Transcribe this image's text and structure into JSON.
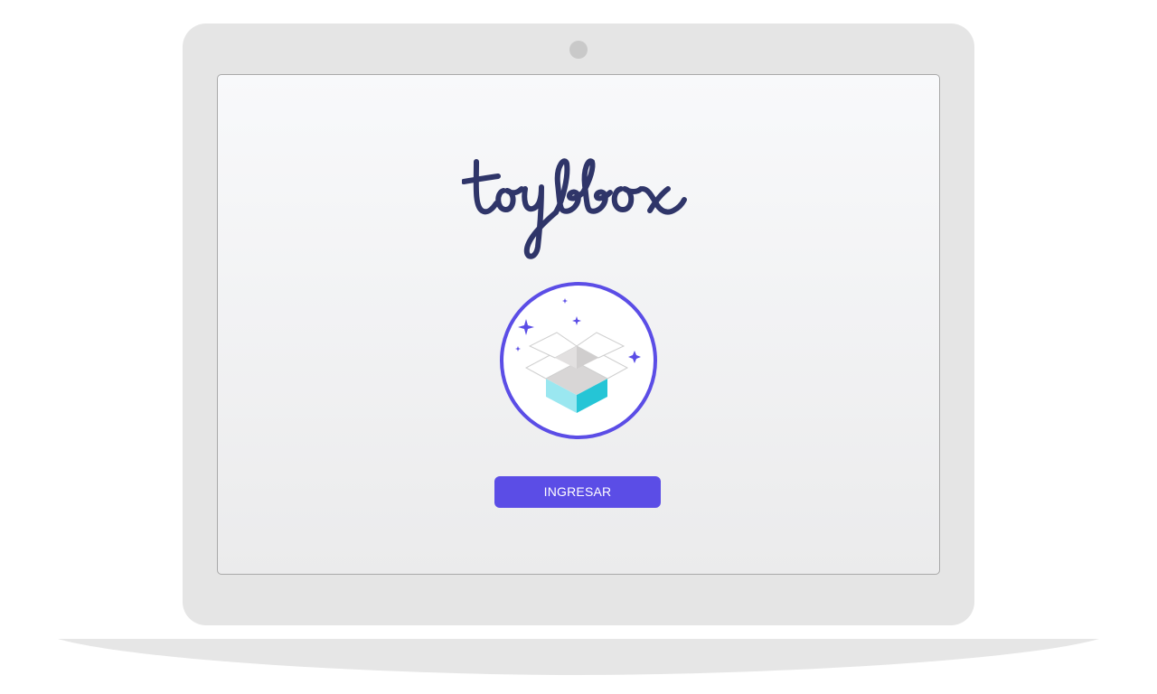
{
  "app": {
    "logo_text": "toybox"
  },
  "hero": {
    "icon": "open-box-sparkles-icon"
  },
  "actions": {
    "login_label": "INGRESAR"
  },
  "colors": {
    "accent": "#5b4de6",
    "logo": "#2f3569",
    "box_cyan": "#35d0e0",
    "lid": "#e5e5e5"
  }
}
